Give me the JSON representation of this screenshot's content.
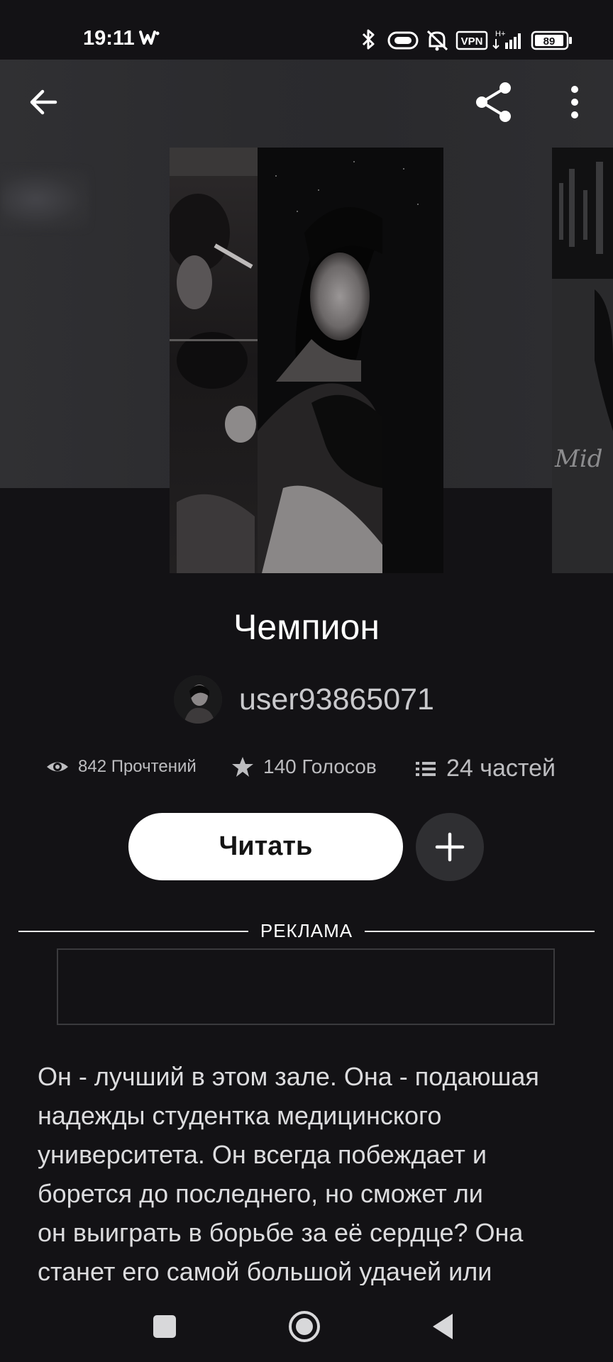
{
  "status_bar": {
    "time": "19:11",
    "vpn_label": "VPN",
    "network_label": "H+",
    "battery_level": "89",
    "icons": [
      "w-app-icon",
      "bluetooth-icon",
      "alarm-pill-icon",
      "bell-muted-icon",
      "vpn-icon",
      "signal-icon",
      "battery-icon"
    ]
  },
  "toolbar": {
    "icons": [
      "back-arrow-icon",
      "share-icon",
      "more-vertical-icon"
    ]
  },
  "story": {
    "title": "Чемпион",
    "author": "user93865071",
    "stats": {
      "reads": "842 Прочтений",
      "votes": "140 Голосов",
      "parts": "24 частей"
    },
    "read_button_label": "Читать",
    "description_lines": [
      "Он - лучший в этом зале. Она - подаюшая",
      "надежды студентка медицинского",
      "университета. Он всегда побеждает и",
      "борется до последнего, но сможет ли",
      "он выиграть в борьбе за её сердце? Она",
      "станет его самой большой удачей или"
    ]
  },
  "ad": {
    "label": "РЕКЛАМА"
  },
  "side_cover_text": "Mid",
  "nav_bar": {
    "icons": [
      "recents-square-icon",
      "home-circle-icon",
      "back-triangle-icon"
    ]
  },
  "colors": {
    "background": "#131215",
    "header_band": "#2c2c2f",
    "primary_button": "#ffffff",
    "secondary_button": "#2f2f32",
    "text_muted": "#bdbdc0"
  }
}
